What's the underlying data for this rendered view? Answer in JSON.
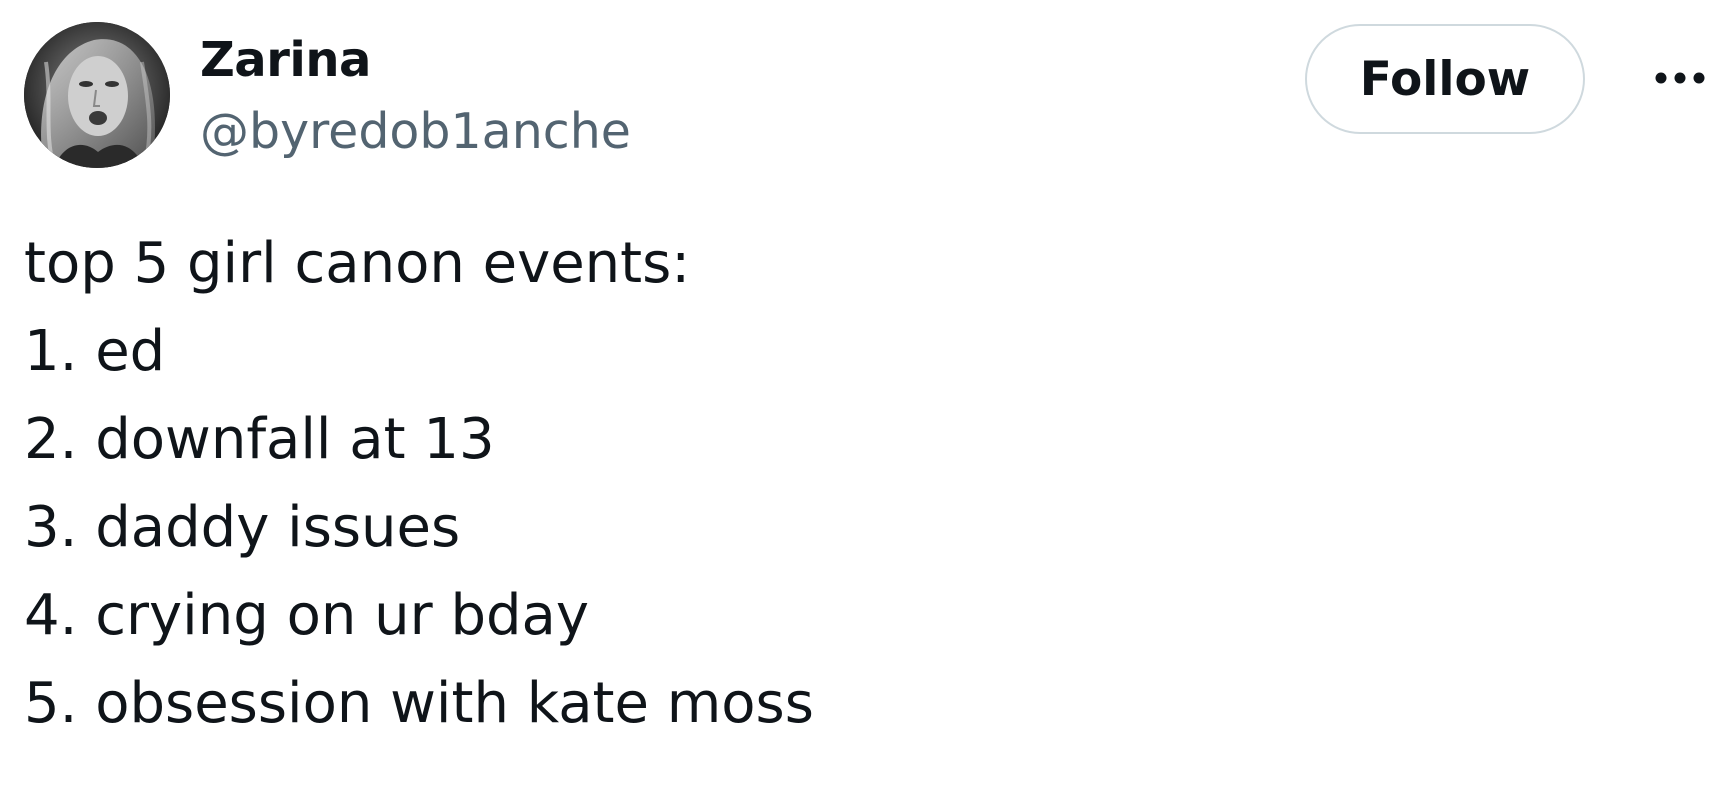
{
  "author": {
    "name": "Zarina",
    "handle": "@byredob1anche",
    "avatar_icon": "user-avatar-photo"
  },
  "actions": {
    "follow_label": "Follow",
    "more_icon": "more-options-icon"
  },
  "tweet": {
    "lines": [
      "top 5 girl canon events:",
      "1. ed",
      "2. downfall at 13",
      "3. daddy issues",
      "4. crying on ur bday",
      "5. obsession with kate moss"
    ]
  },
  "colors": {
    "text_primary": "#0f1419",
    "text_secondary": "#536471",
    "button_border": "#cfd9de",
    "background": "#ffffff"
  }
}
